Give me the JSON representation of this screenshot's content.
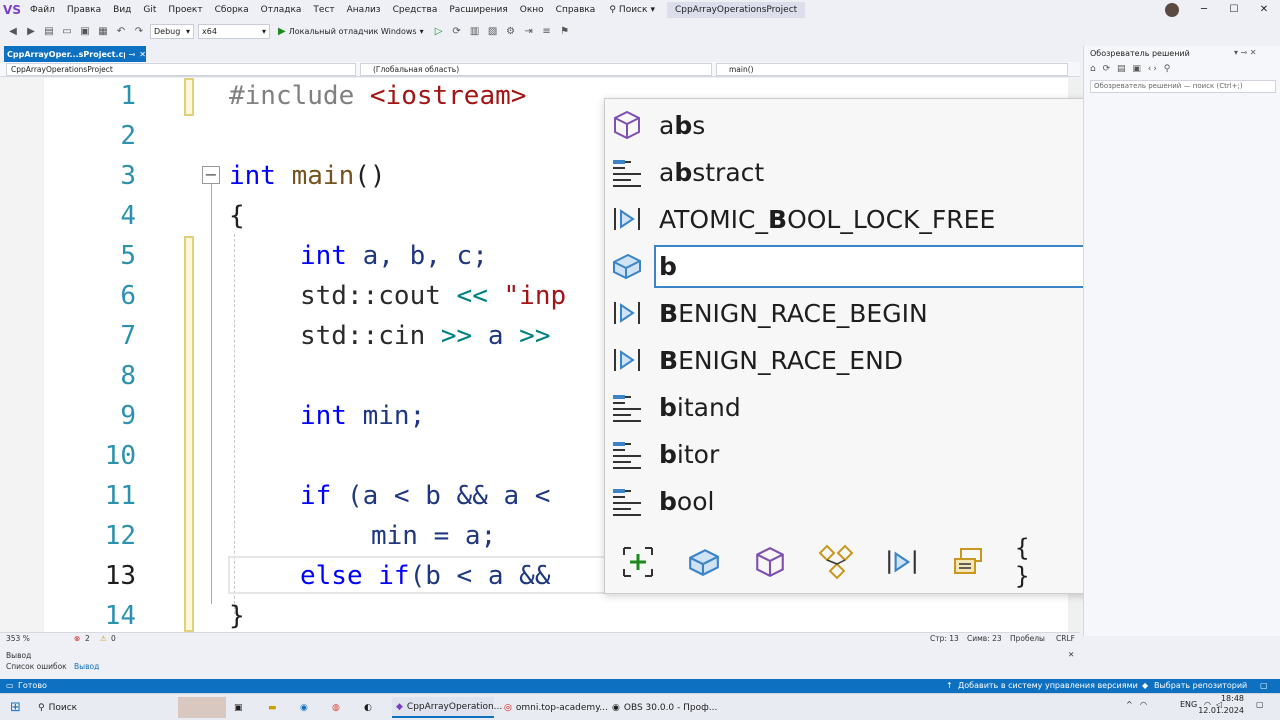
{
  "menubar": {
    "logo": "VS",
    "items": [
      "Файл",
      "Правка",
      "Вид",
      "Git",
      "Проект",
      "Сборка",
      "Отладка",
      "Тест",
      "Анализ",
      "Средства",
      "Расширения",
      "Окно",
      "Справка"
    ],
    "search_label": "Поиск",
    "project_title": "CppArrayOperationsProject"
  },
  "toolbar": {
    "config": "Debug",
    "platform": "x64",
    "run_label": "Локальный отладчик Windows"
  },
  "doc_tab": {
    "label": "CppArrayOper...sProject.cpp*",
    "pin": "⊸",
    "close": "✕"
  },
  "navbar": {
    "project": "CppArrayOperationsProject",
    "scope": "(Глобальная область)",
    "member": "main()"
  },
  "editor": {
    "line_numbers": [
      "1",
      "2",
      "3",
      "4",
      "5",
      "6",
      "7",
      "8",
      "9",
      "10",
      "11",
      "12",
      "13",
      "14"
    ],
    "current_line": "13",
    "lines": {
      "l1": {
        "pp": "#include",
        "inc": "<iostream>"
      },
      "l3": {
        "kw": "int",
        "fn": "main",
        "rest": "()"
      },
      "l4": {
        "text": "{"
      },
      "l5": {
        "kw": "int",
        "vars": "a, b, c;"
      },
      "l6": {
        "ns": "std::cout",
        "op": "<<",
        "str": "\"inp"
      },
      "l7": {
        "ns": "std::cin",
        "op": ">>",
        "var": "a",
        "op2": ">>"
      },
      "l9": {
        "kw": "int",
        "var": "min;"
      },
      "l11": {
        "kw": "if",
        "text": "(a < b && a <"
      },
      "l12": {
        "var": "min = a;"
      },
      "l13": {
        "kw": "else",
        "kw2": "if",
        "text": "(b < a &&"
      },
      "l14": {
        "text": "}"
      }
    }
  },
  "completion": {
    "items": [
      {
        "pre": "a",
        "bold": "b",
        "post": "s",
        "icon": "struct-cube-icon"
      },
      {
        "pre": "a",
        "bold": "b",
        "post": "stract",
        "icon": "keyword-icon"
      },
      {
        "pre": "ATOMIC_",
        "bold": "B",
        "post": "OOL_LOCK_FREE",
        "icon": "macro-icon"
      },
      {
        "pre": "",
        "bold": "b",
        "post": "",
        "icon": "variable-icon"
      },
      {
        "pre": "",
        "bold": "B",
        "post": "ENIGN_RACE_BEGIN",
        "icon": "macro-icon"
      },
      {
        "pre": "",
        "bold": "B",
        "post": "ENIGN_RACE_END",
        "icon": "macro-icon"
      },
      {
        "pre": "",
        "bold": "b",
        "post": "itand",
        "icon": "keyword-icon"
      },
      {
        "pre": "",
        "bold": "b",
        "post": "itor",
        "icon": "keyword-icon"
      },
      {
        "pre": "",
        "bold": "b",
        "post": "ool",
        "icon": "keyword-icon"
      }
    ],
    "selected_index": 3,
    "braces_label": "{ }"
  },
  "statusrow": {
    "zoom": "353 %",
    "errors": "2",
    "warnings": "0",
    "line": "Стр: 13",
    "col": "Симв: 23",
    "spaces": "Пробелы",
    "eol": "CRLF"
  },
  "output": {
    "title": "Вывод",
    "tabs": [
      "Список ошибок",
      "Вывод"
    ]
  },
  "statusbar": {
    "ready": "Готово",
    "add_to_scm": "Добавить в систему управления версиями",
    "select_repo": "Выбрать репозиторий"
  },
  "taskbar": {
    "search": "Поиск",
    "apps": [
      "CppArrayOperation...",
      "omni.top-academy...",
      "OBS 30.0.0 - Проф..."
    ],
    "lang": "ENG",
    "time": "18:48",
    "date": "12.01.2024"
  },
  "solution_explorer": {
    "title": "Обозреватель решений",
    "search_placeholder": "Обозреватель решений — поиск (Ctrl+;)"
  },
  "colors": {
    "accent": "#0e70c0",
    "selection_border": "#3c84c8",
    "keyword": "#0000ff",
    "string": "#a31515",
    "line_number": "#2b91af"
  }
}
